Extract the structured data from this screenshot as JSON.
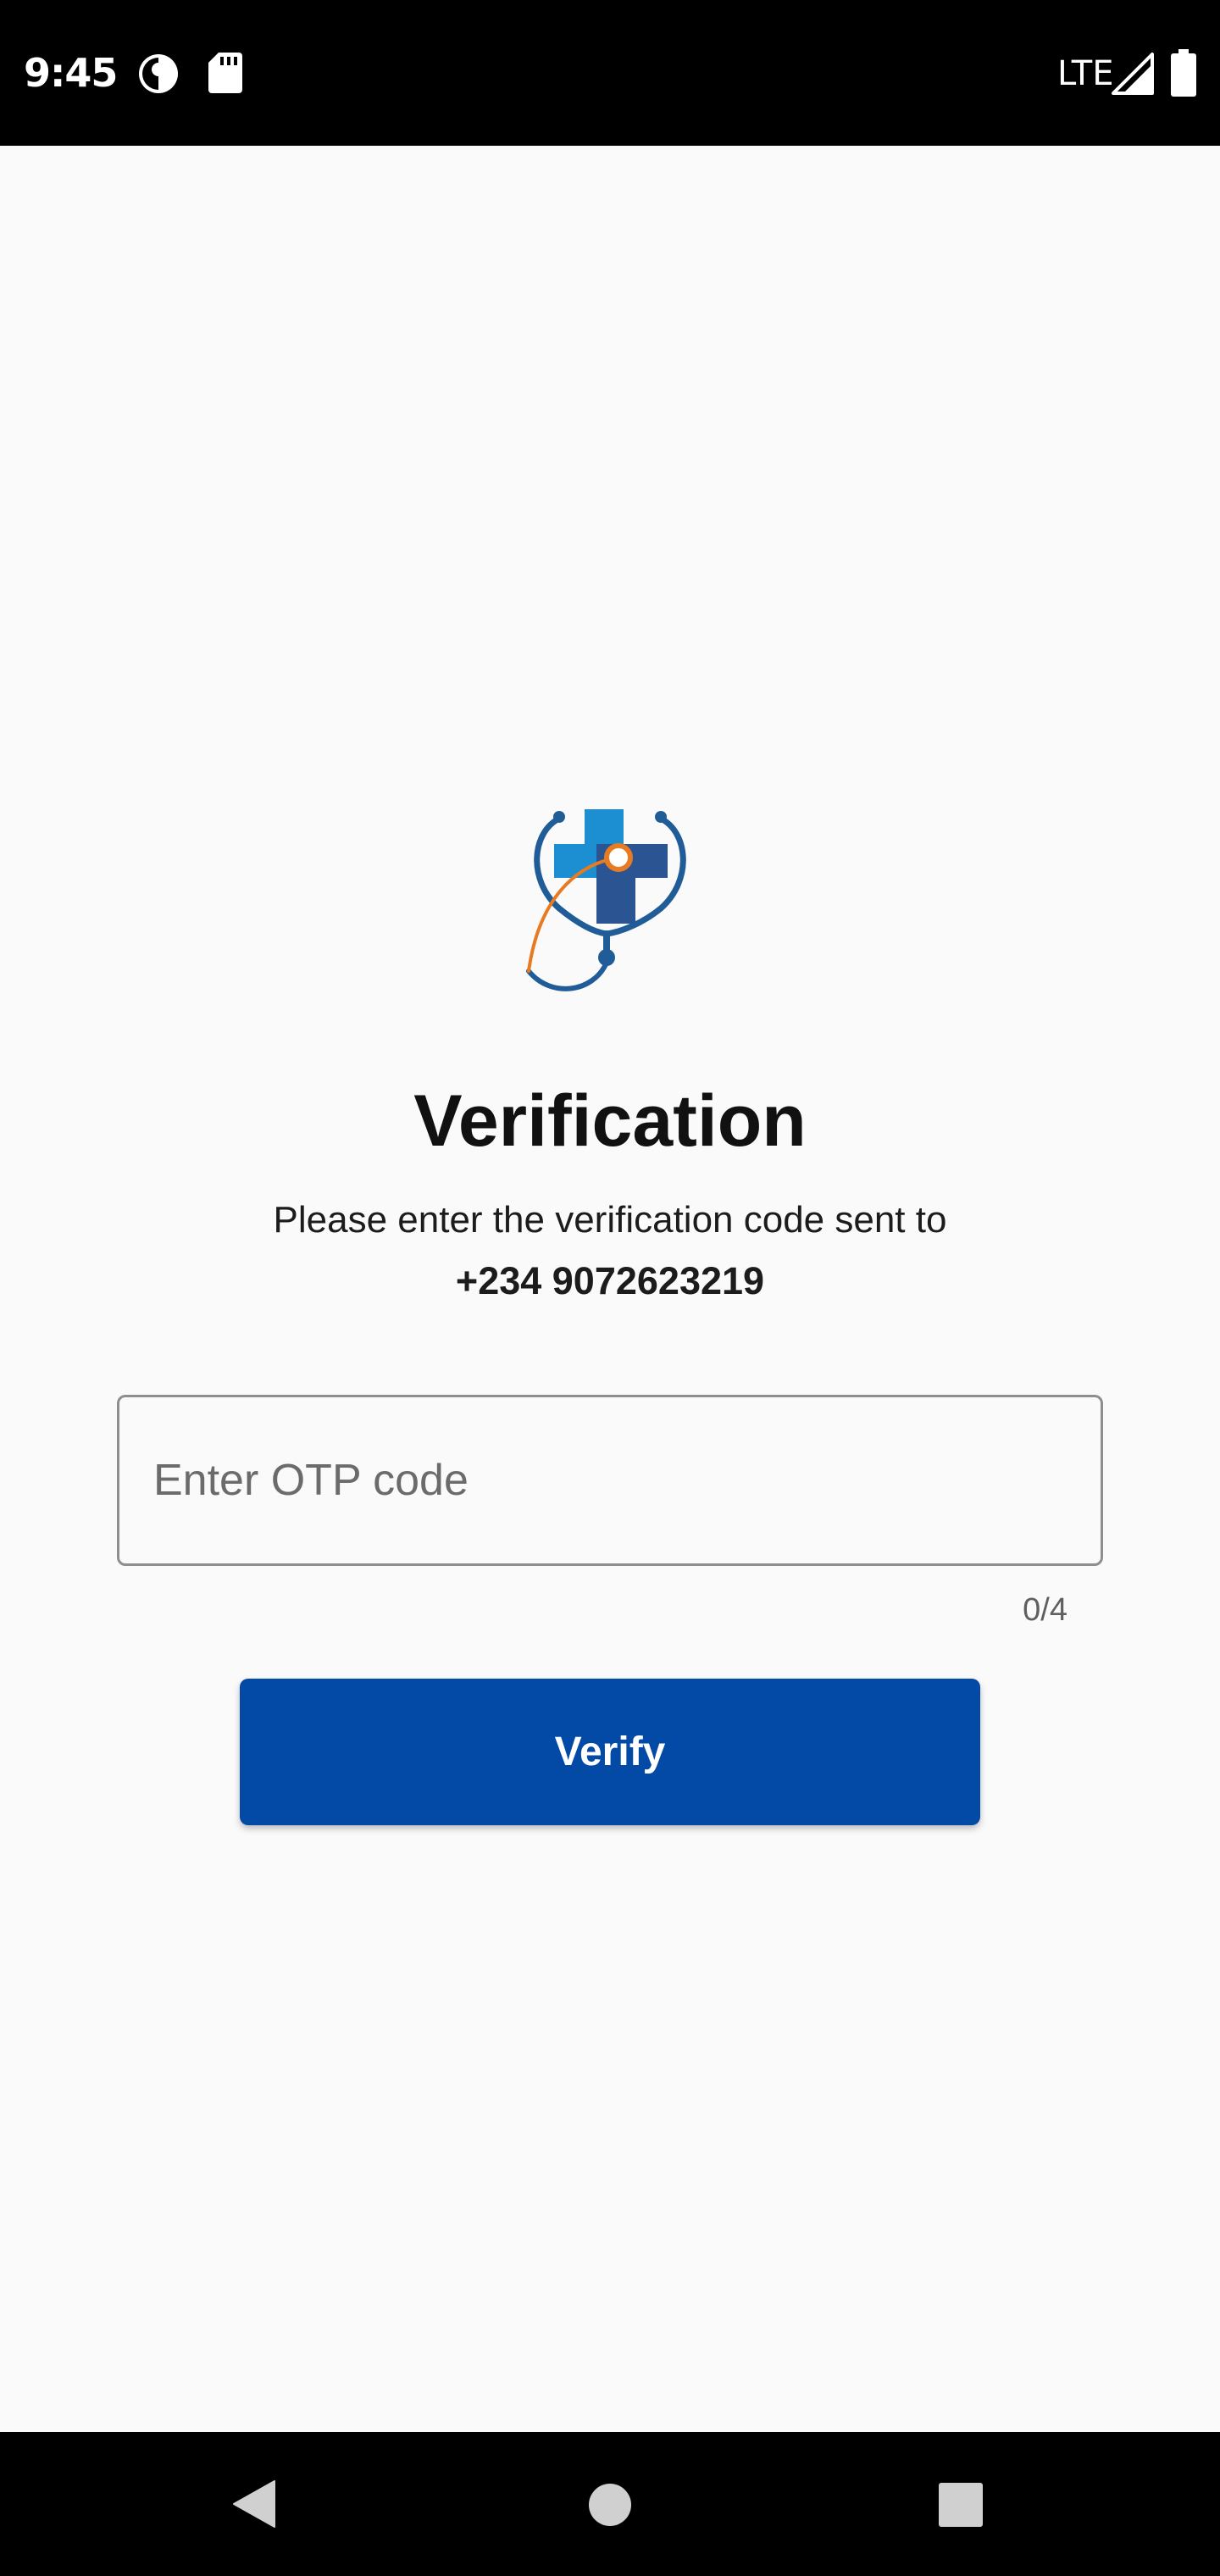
{
  "status_bar": {
    "time": "9:45",
    "network": "LTE",
    "icons": [
      "assistant-icon",
      "sd-card-icon",
      "signal-icon",
      "battery-icon"
    ]
  },
  "logo": {
    "icon": "medical-cross-stethoscope-logo",
    "colors": {
      "cross_light": "#1b8fd1",
      "cross_dark": "#2b5592",
      "stethoscope": "#1f5c98",
      "accent": "#e87a22"
    }
  },
  "verification": {
    "title": "Verification",
    "subtitle": "Please enter the verification code sent to",
    "phone": "+234 9072623219"
  },
  "otp_input": {
    "value": "",
    "placeholder": "Enter OTP code",
    "counter": "0/4"
  },
  "verify_button": {
    "label": "Verify",
    "color": "#034aa6"
  },
  "nav_bar": {
    "icons": [
      "back-icon",
      "home-icon",
      "recents-icon"
    ]
  }
}
